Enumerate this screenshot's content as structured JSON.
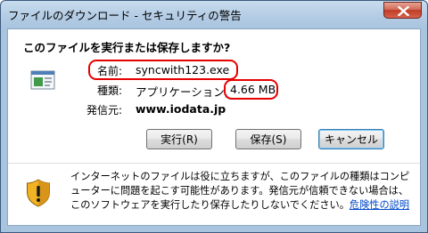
{
  "window": {
    "title": "ファイルのダウンロード - セキュリティの警告"
  },
  "dialog": {
    "question": "このファイルを実行または保存しますか?",
    "file": {
      "name_label": "名前:",
      "name_value": "syncwith123.exe",
      "type_label": "種類:",
      "type_value": "アプリケーション,",
      "size_value": "4.66 MB",
      "from_label": "発信元:",
      "from_value": "www.iodata.jp"
    },
    "buttons": {
      "run": "実行(R)",
      "save": "保存(S)",
      "cancel": "キャンセル"
    },
    "warning": {
      "text": "インターネットのファイルは役に立ちますが、このファイルの種類はコンピューターに問題を起こす可能性があります。発信元が信頼できない場合は、このソフトウェアを実行したり保存したりしないでください。",
      "link": "危険性の説明"
    }
  },
  "annotations": {
    "highlight_color": "#e60000"
  }
}
